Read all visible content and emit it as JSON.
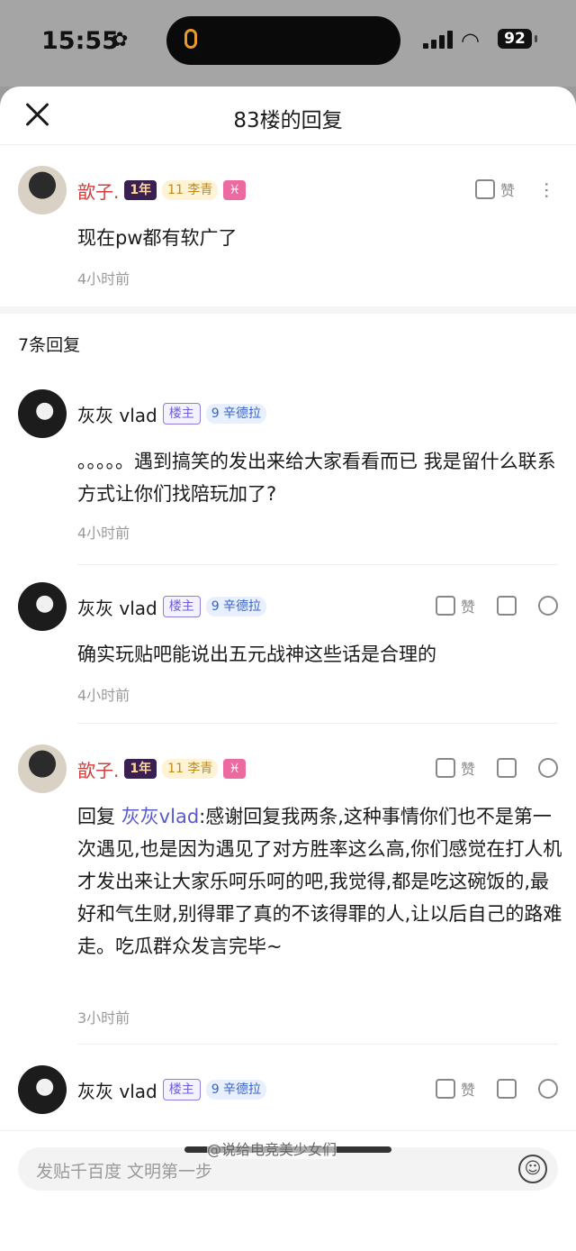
{
  "status": {
    "time": "15:55",
    "battery": "92"
  },
  "header": {
    "title": "83楼的回复"
  },
  "main_comment": {
    "name": "歆子.",
    "badge_year": "1年",
    "badge_level": "11 李青",
    "badge_star": "♓",
    "text": "现在pw都有软广了",
    "time": "4小时前",
    "like_label": "赞"
  },
  "replies_count": "7条回复",
  "replies": [
    {
      "name": "灰灰 vlad",
      "host": "楼主",
      "level": "9 辛德拉",
      "text": "。。。。。遇到搞笑的发出来给大家看看而已 我是留什么联系方式让你们找陪玩加了?",
      "time": "4小时前"
    },
    {
      "name": "灰灰 vlad",
      "host": "楼主",
      "level": "9 辛德拉",
      "text": "确实玩贴吧能说出五元战神这些话是合理的",
      "time": "4小时前",
      "like_label": "赞"
    },
    {
      "name": "歆子.",
      "year": "1年",
      "level": "11 李青",
      "star": "♓",
      "reply_prefix": "回复 ",
      "reply_to": "灰灰vlad",
      "text": ":感谢回复我两条,这种事情你们也不是第一次遇见,也是因为遇见了对方胜率这么高,你们感觉在打人机才发出来让大家乐呵乐呵的吧,我觉得,都是吃这碗饭的,最好和气生财,别得罪了真的不该得罪的人,让以后自己的路难走。吃瓜群众发言完毕~",
      "time": "3小时前",
      "like_label": "赞"
    },
    {
      "name": "灰灰 vlad",
      "host": "楼主",
      "level": "9 辛德拉",
      "like_label": "赞"
    }
  ],
  "input": {
    "placeholder": "发贴千百度 文明第一步"
  },
  "watermark": "@说给电竞美少女们"
}
